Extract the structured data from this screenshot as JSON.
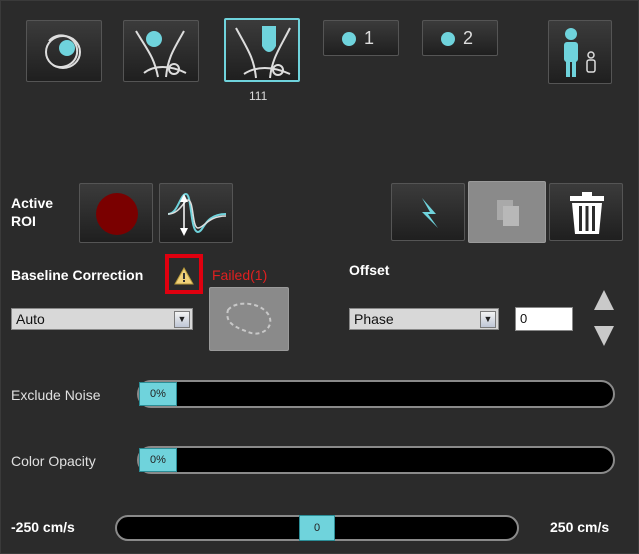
{
  "toolbar": {
    "series_count": "111",
    "roi1_label": "1",
    "roi2_label": "2"
  },
  "roi": {
    "active_label": "Active\nROI",
    "active_color": "#7a0000"
  },
  "baseline": {
    "label": "Baseline Correction",
    "status": "Failed(1)",
    "method_value": "Auto"
  },
  "offset": {
    "label": "Offset",
    "type_value": "Phase",
    "value": "0"
  },
  "sliders": {
    "exclude_noise_label": "Exclude Noise",
    "exclude_noise_value": "0%",
    "exclude_noise_fraction": 0,
    "color_opacity_label": "Color Opacity",
    "color_opacity_value": "0%",
    "color_opacity_fraction": 0,
    "velocity_min_label": "-250 cm/s",
    "velocity_max_label": "250 cm/s",
    "velocity_value": "0"
  },
  "colors": {
    "accent": "#6fd3dc",
    "warning_highlight": "#e0000f",
    "failed_text": "#e02020"
  }
}
